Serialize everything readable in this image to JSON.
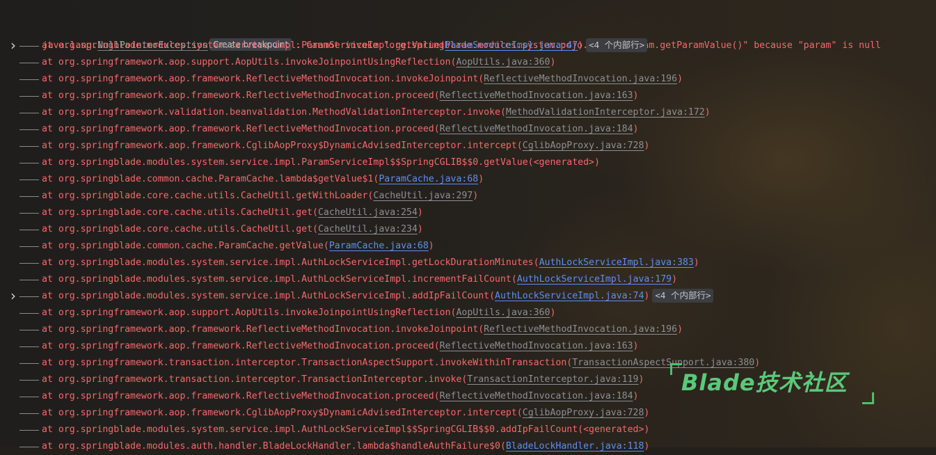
{
  "header": {
    "exception_class": "java.lang.",
    "exception_name": "NullPointerException",
    "create_breakpoint": "Create breakpoint",
    "message": ": Cannot invoke \"org.springblade.modules.system.pojo.entity.Param.getParamValue()\" because \"param\" is null"
  },
  "frames": [
    {
      "method": "at org.springblade.modules.system.service.impl.ParamServiceImpl.getValue(",
      "source": "ParamServiceImpl.java:47",
      "link": true,
      "tail": ")",
      "fold": "<4 个内部行>",
      "expandable": true
    },
    {
      "method": "at org.springframework.aop.support.AopUtils.invokeJoinpointUsingReflection(",
      "source": "AopUtils.java:360",
      "link": false,
      "tail": ")"
    },
    {
      "method": "at org.springframework.aop.framework.ReflectiveMethodInvocation.invokeJoinpoint(",
      "source": "ReflectiveMethodInvocation.java:196",
      "link": false,
      "tail": ")"
    },
    {
      "method": "at org.springframework.aop.framework.ReflectiveMethodInvocation.proceed(",
      "source": "ReflectiveMethodInvocation.java:163",
      "link": false,
      "tail": ")"
    },
    {
      "method": "at org.springframework.validation.beanvalidation.MethodValidationInterceptor.invoke(",
      "source": "MethodValidationInterceptor.java:172",
      "link": false,
      "tail": ")"
    },
    {
      "method": "at org.springframework.aop.framework.ReflectiveMethodInvocation.proceed(",
      "source": "ReflectiveMethodInvocation.java:184",
      "link": false,
      "tail": ")"
    },
    {
      "method": "at org.springframework.aop.framework.CglibAopProxy$DynamicAdvisedInterceptor.intercept(",
      "source": "CglibAopProxy.java:728",
      "link": false,
      "tail": ")"
    },
    {
      "method": "at org.springblade.modules.system.service.impl.ParamServiceImpl$$SpringCGLIB$$0.getValue(<generated>)"
    },
    {
      "method": "at org.springblade.common.cache.ParamCache.lambda$getValue$1(",
      "source": "ParamCache.java:68",
      "link": true,
      "tail": ")"
    },
    {
      "method": "at org.springblade.core.cache.utils.CacheUtil.getWithLoader(",
      "source": "CacheUtil.java:297",
      "link": false,
      "tail": ")"
    },
    {
      "method": "at org.springblade.core.cache.utils.CacheUtil.get(",
      "source": "CacheUtil.java:254",
      "link": false,
      "tail": ")"
    },
    {
      "method": "at org.springblade.core.cache.utils.CacheUtil.get(",
      "source": "CacheUtil.java:234",
      "link": false,
      "tail": ")"
    },
    {
      "method": "at org.springblade.common.cache.ParamCache.getValue(",
      "source": "ParamCache.java:68",
      "link": true,
      "tail": ")"
    },
    {
      "method": "at org.springblade.modules.system.service.impl.AuthLockServiceImpl.getLockDurationMinutes(",
      "source": "AuthLockServiceImpl.java:383",
      "link": true,
      "tail": ")"
    },
    {
      "method": "at org.springblade.modules.system.service.impl.AuthLockServiceImpl.incrementFailCount(",
      "source": "AuthLockServiceImpl.java:179",
      "link": true,
      "tail": ")"
    },
    {
      "method": "at org.springblade.modules.system.service.impl.AuthLockServiceImpl.addIpFailCount(",
      "source": "AuthLockServiceImpl.java:74",
      "link": true,
      "tail": ")",
      "fold": "<4 个内部行>",
      "expandable": true
    },
    {
      "method": "at org.springframework.aop.support.AopUtils.invokeJoinpointUsingReflection(",
      "source": "AopUtils.java:360",
      "link": false,
      "tail": ")"
    },
    {
      "method": "at org.springframework.aop.framework.ReflectiveMethodInvocation.invokeJoinpoint(",
      "source": "ReflectiveMethodInvocation.java:196",
      "link": false,
      "tail": ")"
    },
    {
      "method": "at org.springframework.aop.framework.ReflectiveMethodInvocation.proceed(",
      "source": "ReflectiveMethodInvocation.java:163",
      "link": false,
      "tail": ")"
    },
    {
      "method": "at org.springframework.transaction.interceptor.TransactionAspectSupport.invokeWithinTransaction(",
      "source": "TransactionAspectSupport.java:380",
      "link": false,
      "tail": ")"
    },
    {
      "method": "at org.springframework.transaction.interceptor.TransactionInterceptor.invoke(",
      "source": "TransactionInterceptor.java:119",
      "link": false,
      "tail": ")"
    },
    {
      "method": "at org.springframework.aop.framework.ReflectiveMethodInvocation.proceed(",
      "source": "ReflectiveMethodInvocation.java:184",
      "link": false,
      "tail": ")"
    },
    {
      "method": "at org.springframework.aop.framework.CglibAopProxy$DynamicAdvisedInterceptor.intercept(",
      "source": "CglibAopProxy.java:728",
      "link": false,
      "tail": ")"
    },
    {
      "method": "at org.springblade.modules.system.service.impl.AuthLockServiceImpl$$SpringCGLIB$$0.addIpFailCount(<generated>)"
    },
    {
      "method": "at org.springblade.modules.auth.handler.BladeLockHandler.lambda$handleAuthFailure$0(",
      "source": "BladeLockHandler.java:118",
      "link": true,
      "tail": ")"
    }
  ],
  "watermark": {
    "text": "Blade技术社区"
  },
  "colors": {
    "background": "#23201c",
    "error_text": "#f7686a",
    "link": "#5c8ff2",
    "library_link": "#8d8f93",
    "watermark": "#5ac97a"
  }
}
